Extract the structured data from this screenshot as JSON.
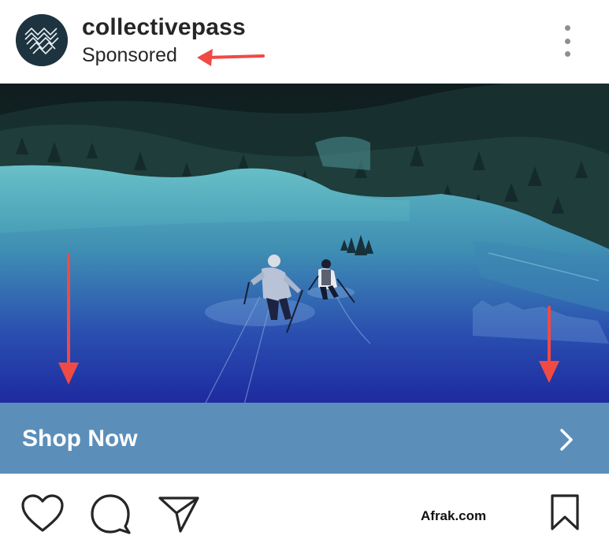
{
  "post": {
    "username": "collectivepass",
    "sponsored_label": "Sponsored",
    "cta_label": "Shop Now"
  },
  "watermark": "Afrak.com",
  "icons": {
    "avatar": "collectivepass-logo",
    "more": "more-options-icon",
    "cta": "chevron-right-icon",
    "like": "heart-icon",
    "comment": "comment-icon",
    "share": "send-icon",
    "save": "bookmark-icon"
  },
  "colors": {
    "cta_bar": "#5b8fb9",
    "annotation_arrow": "#f04a45",
    "text": "#262626"
  }
}
